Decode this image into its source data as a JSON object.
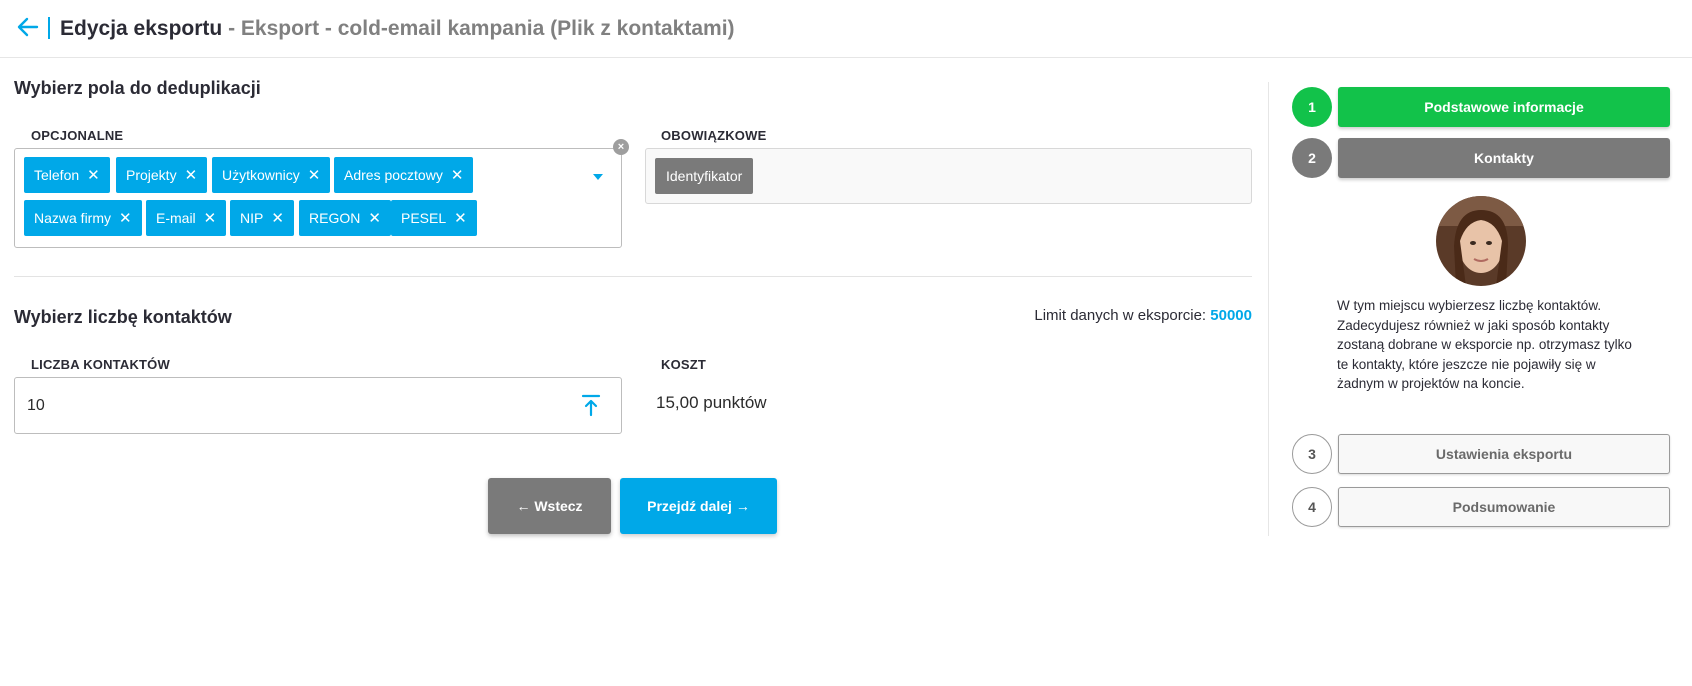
{
  "header": {
    "title": "Edycja eksportu",
    "subtitle": " - Eksport - cold-email kampania (Plik z kontaktami)"
  },
  "dedup": {
    "title": "Wybierz pola do deduplikacji",
    "optional_label": "OPCJONALNE",
    "mandatory_label": "OBOWIĄZKOWE",
    "optional_tags": [
      "Telefon",
      "Projekty",
      "Użytkownicy",
      "Adres pocztowy",
      "Nazwa firmy",
      "E-mail",
      "NIP",
      "REGON",
      "PESEL"
    ],
    "mandatory_tag": "Identyfikator"
  },
  "contacts": {
    "title": "Wybierz liczbę kontaktów",
    "limit_label": "Limit danych w eksporcie:",
    "limit_value": "50000",
    "count_label": "LICZBA KONTAKTÓW",
    "count_value": "10",
    "cost_label": "KOSZT",
    "cost_value": "15,00 punktów"
  },
  "buttons": {
    "back": "← Wstecz",
    "next": "Przejdź dalej →"
  },
  "steps": [
    {
      "number": "1",
      "label": "Podstawowe informacje",
      "state": "done"
    },
    {
      "number": "2",
      "label": "Kontakty",
      "state": "active"
    },
    {
      "number": "3",
      "label": "Ustawienia eksportu",
      "state": "pending"
    },
    {
      "number": "4",
      "label": "Podsumowanie",
      "state": "pending"
    }
  ],
  "help_text": "W tym miejscu wybierzesz liczbę kontaktów. Zadecydujesz również w jaki sposób kontakty zostaną dobrane w eksporcie np. otrzymasz tylko te kontakty, które jeszcze nie pojawiły się w żadnym w projektów na koncie.",
  "colors": {
    "accent": "#00a8e8",
    "success": "#12c24a",
    "neutral": "#7a7a7a"
  }
}
